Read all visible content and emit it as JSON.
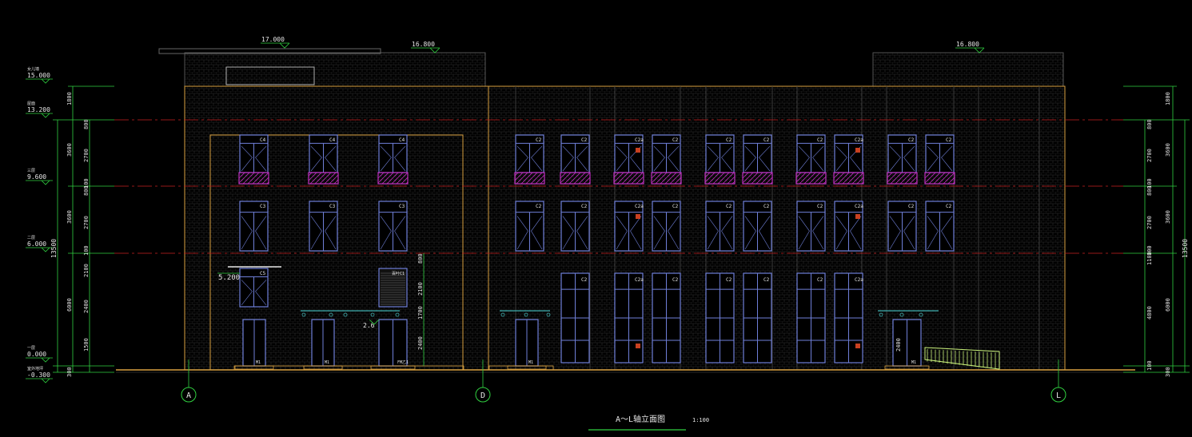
{
  "drawing": {
    "title": "A～L轴立面图",
    "scale": "1:100"
  },
  "colors": {
    "background": "#000000",
    "wall": "#d8a040",
    "wall_hatch": "#3c3c3c",
    "window": "#6f7fd8",
    "balustrade": "#c030c0",
    "level_line": "#c82020",
    "dimension": "#30d040",
    "text": "#e6e6e6",
    "railing": "#c8f07a",
    "canopy": "#40b0b0",
    "ground": "#d8a040"
  },
  "top_elevations": {
    "left_roof": "17.000",
    "left_roof_parapet": "16.800",
    "right_roof": "16.800"
  },
  "left_levels": [
    {
      "name": "女儿墙",
      "value": "15.000"
    },
    {
      "name": "屋面",
      "value": "13.200"
    },
    {
      "name": "三层",
      "value": "9.600"
    },
    {
      "name": "二层",
      "value": "6.000"
    },
    {
      "name": "一层",
      "value": "0.000"
    },
    {
      "name": "室外地坪",
      "value": "-0.300"
    }
  ],
  "canopy_level": "5.200",
  "canopy_small_level": "2.6",
  "left_dims_inner": [
    "800",
    "2700",
    "100",
    "800",
    "2700",
    "100",
    "2100",
    "2400",
    "1500"
  ],
  "left_dims_outer": [
    "1800",
    "3600",
    "3600",
    "6000",
    "300"
  ],
  "left_dim_total": "13500",
  "right_dims_inner": [
    "800",
    "2700",
    "100",
    "800",
    "2700",
    "100",
    "1100",
    "4800",
    "100"
  ],
  "right_dims_outer": [
    "1800",
    "3600",
    "3600",
    "6000",
    "300"
  ],
  "right_dim_total": "13500",
  "mid_dims": [
    "800",
    "2100",
    "1700",
    "2400"
  ],
  "door_dim": "2400",
  "axes": [
    "A",
    "D",
    "L"
  ],
  "window_tags": {
    "upper": "C4",
    "typical": "C3",
    "stair": "C5",
    "tall": "C2",
    "tall_alt": "C2a",
    "door": "M1",
    "door_main": "FM乙1",
    "louver": "百叶C1"
  }
}
